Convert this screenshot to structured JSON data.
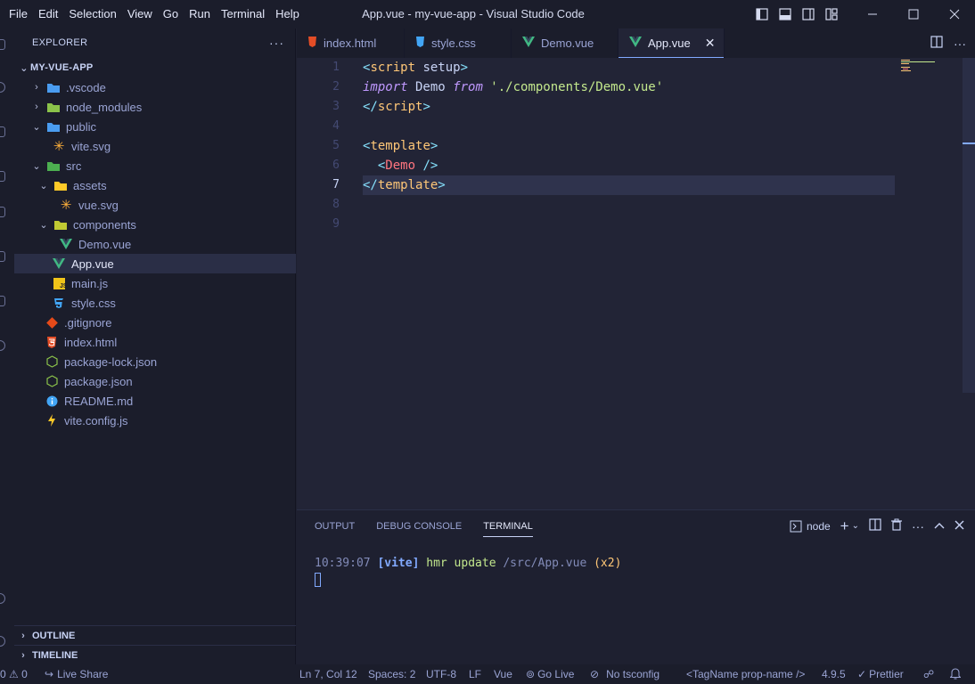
{
  "window": {
    "title": "App.vue - my-vue-app - Visual Studio Code",
    "menu": [
      "File",
      "Edit",
      "Selection",
      "View",
      "Go",
      "Run",
      "Terminal",
      "Help"
    ]
  },
  "sidebar": {
    "title": "EXPLORER",
    "more": "···",
    "root": "MY-VUE-APP",
    "tree": [
      {
        "label": ".vscode",
        "icon": "folder-vscode-icon",
        "color": "#4a9cf0"
      },
      {
        "label": "node_modules",
        "icon": "folder-node-icon",
        "color": "#8bc34a"
      },
      {
        "label": "public",
        "icon": "folder-public-icon",
        "color": "#4a9cf0"
      },
      {
        "label": "vite.svg",
        "icon": "svg-icon",
        "color": "#ffb13b"
      },
      {
        "label": "src",
        "icon": "folder-src-icon",
        "color": "#4caf50"
      },
      {
        "label": "assets",
        "icon": "folder-assets-icon",
        "color": "#ffca28"
      },
      {
        "label": "vue.svg",
        "icon": "svg-icon",
        "color": "#ffb13b"
      },
      {
        "label": "components",
        "icon": "folder-components-icon",
        "color": "#c0ca33"
      },
      {
        "label": "Demo.vue",
        "icon": "vue-icon",
        "color": "#41b883"
      },
      {
        "label": "App.vue",
        "icon": "vue-icon",
        "color": "#41b883"
      },
      {
        "label": "main.js",
        "icon": "js-icon",
        "color": "#f0c419"
      },
      {
        "label": "style.css",
        "icon": "css-icon",
        "color": "#42a5f5"
      },
      {
        "label": ".gitignore",
        "icon": "git-icon",
        "color": "#e64a19"
      },
      {
        "label": "index.html",
        "icon": "html-icon",
        "color": "#e44d26"
      },
      {
        "label": "package-lock.json",
        "icon": "nodejs-icon",
        "color": "#8bc34a"
      },
      {
        "label": "package.json",
        "icon": "nodejs-icon",
        "color": "#8bc34a"
      },
      {
        "label": "README.md",
        "icon": "info-icon",
        "color": "#42a5f5"
      },
      {
        "label": "vite.config.js",
        "icon": "vite-icon",
        "color": "#ffca28"
      }
    ],
    "outline": "OUTLINE",
    "timeline": "TIMELINE"
  },
  "tabs": [
    {
      "label": "index.html",
      "icon": "html-icon",
      "color": "#e44d26"
    },
    {
      "label": "style.css",
      "icon": "css-icon",
      "color": "#42a5f5"
    },
    {
      "label": "Demo.vue",
      "icon": "vue-icon",
      "color": "#41b883"
    },
    {
      "label": "App.vue",
      "icon": "vue-icon",
      "color": "#41b883",
      "active": true
    }
  ],
  "editor": {
    "line_numbers": [
      "1",
      "2",
      "3",
      "4",
      "5",
      "6",
      "7",
      "8",
      "9"
    ],
    "current_line": 7,
    "code": {
      "l1_open": "<",
      "l1_tag": "script",
      "l1_attr": " setup",
      "l1_close": ">",
      "l2_kw1": "import",
      "l2_name": " Demo ",
      "l2_kw2": "from",
      "l2_str": " './components/Demo.vue'",
      "l3_open": "</",
      "l3_tag": "script",
      "l3_close": ">",
      "l5_open": "<",
      "l5_tag": "template",
      "l5_close": ">",
      "l6_indent": "  ",
      "l6_open": "<",
      "l6_tag": "Demo",
      "l6_close": " />",
      "l7_open": "</",
      "l7_tag": "template",
      "l7_close": ">"
    }
  },
  "panel": {
    "tabs": [
      "OUTPUT",
      "DEBUG CONSOLE",
      "TERMINAL"
    ],
    "active_tab": "TERMINAL",
    "terminal_name": "node",
    "terminal": {
      "time": "10:39:07",
      "tag": "[vite]",
      "msg": "hmr update",
      "path": "/src/App.vue",
      "count": "(x2)"
    }
  },
  "statusbar": {
    "problems": "0 ⚠ 0",
    "live_share": "Live Share",
    "position": "Ln 7, Col 12",
    "spaces": "Spaces: 2",
    "encoding": "UTF-8",
    "eol": "LF",
    "language": "Vue",
    "go_live": "Go Live",
    "tsconfig": "No tsconfig",
    "tagname": "<TagName prop-name />",
    "version": "4.9.5",
    "prettier": "Prettier"
  },
  "colors": {
    "accent": "#82aaff",
    "editor_bg": "#222436",
    "sidebar_bg": "#1b1d2b"
  }
}
